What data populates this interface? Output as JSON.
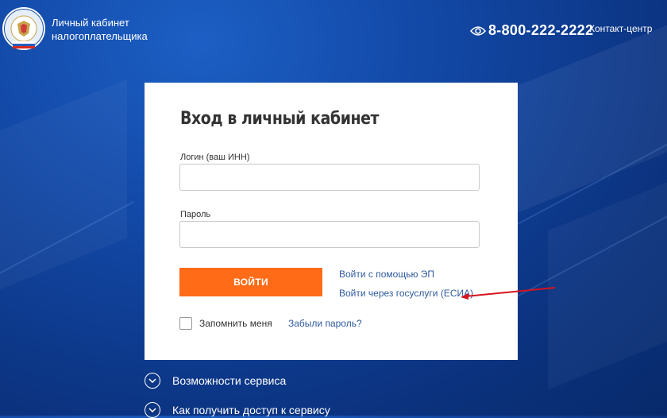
{
  "header": {
    "brand_line1": "Личный кабинет",
    "brand_line2": "налогоплательщика",
    "phone": "8-800-222-2222",
    "contact_center": "Контакт-центр",
    "logo_text": "ФЕДЕРАЛЬНАЯ НАЛОГОВАЯ СЛУЖБА"
  },
  "login": {
    "title": "Вход в личный кабинет",
    "login_label": "Логин (ваш ИНН)",
    "login_value": "",
    "password_label": "Пароль",
    "password_value": "",
    "submit_label": "ВОЙТИ",
    "ep_link": "Войти с помощью ЭП",
    "gosuslugi_link": "Войти через госуслуги (ЕСИА)",
    "remember_label": "Запомнить меня",
    "remember_checked": false,
    "forgot_link": "Забыли пароль?"
  },
  "info": {
    "item1": "Возможности сервиса",
    "item2": "Как получить доступ к сервису"
  },
  "colors": {
    "accent_orange": "#ff6b16",
    "link_blue": "#2f5a9e",
    "annotation_red": "#d6141c",
    "background_blue": "#1248a6"
  }
}
